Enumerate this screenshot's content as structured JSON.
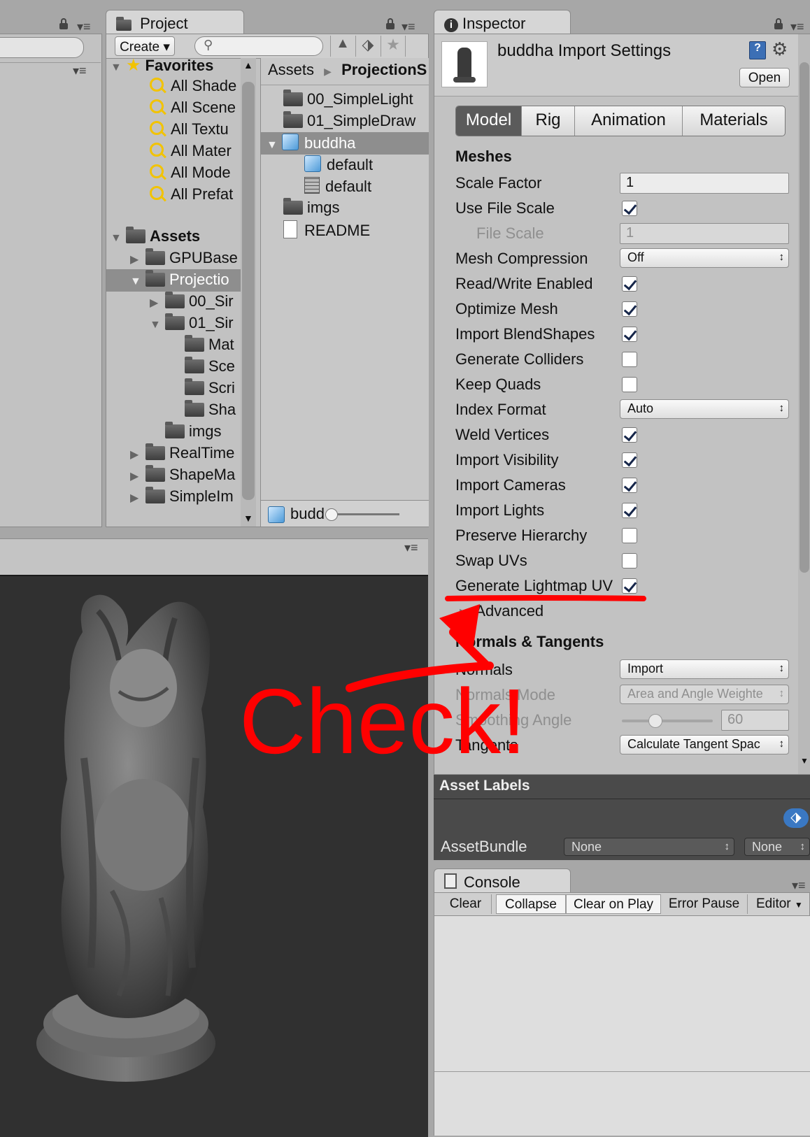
{
  "hierarchy": {},
  "project": {
    "tab": "Project",
    "create_label": "Create",
    "favorites": {
      "title": "Favorites",
      "items": [
        "All Shade",
        "All Scene",
        "All Textu",
        "All Mater",
        "All Mode",
        "All Prefat"
      ]
    },
    "assets_tree": {
      "title": "Assets",
      "items": [
        "GPUBase",
        "Projectio",
        "00_Sir",
        "01_Sir",
        "Mat",
        "Sce",
        "Scri",
        "Sha",
        "imgs",
        "RealTime",
        "ShapeMa",
        "SimpleIm"
      ]
    },
    "breadcrumb": {
      "root": "Assets",
      "current": "ProjectionS"
    },
    "files": [
      "00_SimpleLight",
      "01_SimpleDraw",
      "buddha",
      "default",
      "default",
      "imgs",
      "README"
    ],
    "footer_label": "budd"
  },
  "inspector": {
    "tab": "Inspector",
    "title": "buddha Import Settings",
    "open_label": "Open",
    "tabs": [
      "Model",
      "Rig",
      "Animation",
      "Materials"
    ],
    "meshes_header": "Meshes",
    "scale_factor": {
      "label": "Scale Factor",
      "value": "1"
    },
    "use_file_scale": {
      "label": "Use File Scale",
      "checked": true
    },
    "file_scale": {
      "label": "File Scale",
      "value": "1"
    },
    "mesh_compression": {
      "label": "Mesh Compression",
      "value": "Off"
    },
    "read_write": {
      "label": "Read/Write Enabled",
      "checked": true
    },
    "optimize_mesh": {
      "label": "Optimize Mesh",
      "checked": true
    },
    "import_blendshapes": {
      "label": "Import BlendShapes",
      "checked": true
    },
    "generate_colliders": {
      "label": "Generate Colliders",
      "checked": false
    },
    "keep_quads": {
      "label": "Keep Quads",
      "checked": false
    },
    "index_format": {
      "label": "Index Format",
      "value": "Auto"
    },
    "weld_vertices": {
      "label": "Weld Vertices",
      "checked": true
    },
    "import_visibility": {
      "label": "Import Visibility",
      "checked": true
    },
    "import_cameras": {
      "label": "Import Cameras",
      "checked": true
    },
    "import_lights": {
      "label": "Import Lights",
      "checked": true
    },
    "preserve_hierarchy": {
      "label": "Preserve Hierarchy",
      "checked": false
    },
    "swap_uvs": {
      "label": "Swap UVs",
      "checked": false
    },
    "generate_lightmap_uv": {
      "label": "Generate Lightmap UV",
      "checked": true
    },
    "advanced_label": "Advanced",
    "normals_header": "Normals & Tangents",
    "normals": {
      "label": "Normals",
      "value": "Import"
    },
    "normals_mode": {
      "label": "Normals Mode",
      "value": "Area and Angle Weighte"
    },
    "smoothing_angle": {
      "label": "Smoothing Angle",
      "value": "60"
    },
    "tangents": {
      "label": "Tangents",
      "value": "Calculate Tangent Spac"
    }
  },
  "asset_labels": {
    "title": "Asset Labels",
    "assetbundle_label": "AssetBundle",
    "bundle_value": "None",
    "variant_value": "None"
  },
  "console": {
    "tab": "Console",
    "buttons": [
      "Clear",
      "Collapse",
      "Clear on Play",
      "Error Pause",
      "Editor"
    ]
  },
  "annotation": {
    "text": "Check!",
    "color": "#ff0000"
  },
  "colors": {
    "highlight": "#5b5b5b",
    "selected_row": "#8e8e8e",
    "viewport": "#303030",
    "accent_blue": "#3a78c3"
  }
}
